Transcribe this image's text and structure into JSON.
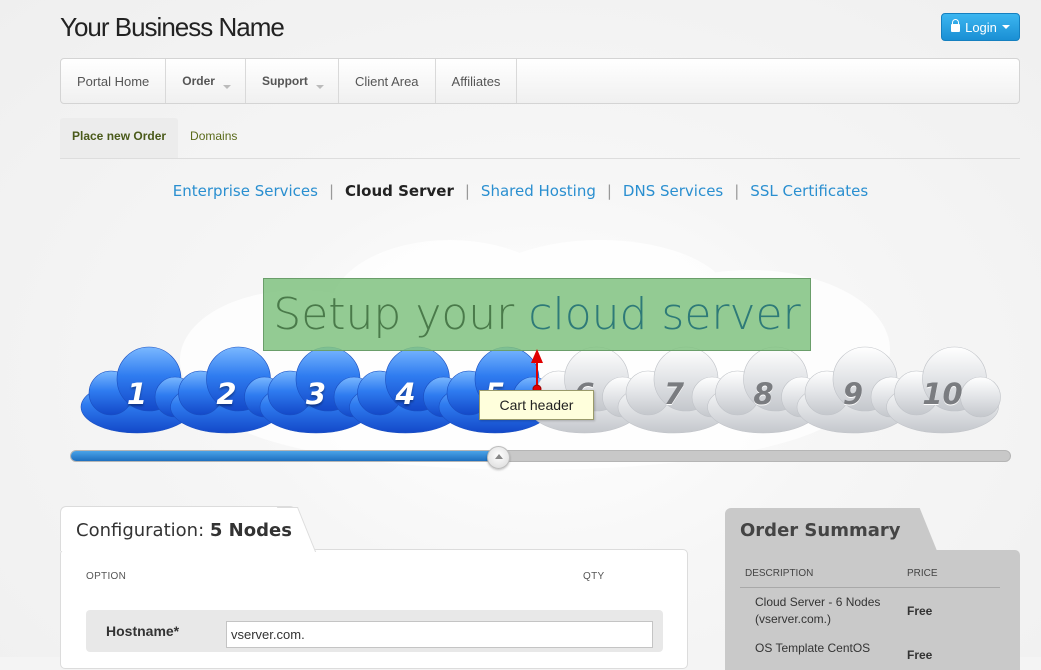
{
  "brand": {
    "name": "Your Business Name"
  },
  "login": {
    "label": "Login"
  },
  "nav": {
    "items": [
      {
        "label": "Portal Home"
      },
      {
        "label": "Order"
      },
      {
        "label": "Support"
      },
      {
        "label": "Client Area"
      },
      {
        "label": "Affiliates"
      }
    ]
  },
  "subnav": {
    "tabs": [
      {
        "label": "Place new Order"
      },
      {
        "label": "Domains"
      }
    ]
  },
  "categories": {
    "items": [
      {
        "label": "Enterprise Services"
      },
      {
        "label": "Cloud Server"
      },
      {
        "label": "Shared Hosting"
      },
      {
        "label": "DNS Services"
      },
      {
        "label": "SSL Certificates"
      }
    ],
    "separator": "|"
  },
  "banner": {
    "part1": "Setup your",
    "part2": "cloud server"
  },
  "node_selector": {
    "numbers": [
      "1",
      "2",
      "3",
      "4",
      "5",
      "6",
      "7",
      "8",
      "9",
      "10"
    ],
    "selected_count": 5,
    "slider_fraction": 0.455
  },
  "annotation": {
    "tooltip": "Cart header",
    "colors": {
      "fill": "#ffffdc",
      "arrow": "#e00000"
    }
  },
  "configuration": {
    "title_prefix": "Configuration:",
    "title_value": "5 Nodes",
    "col_option": "OPTION",
    "col_qty": "QTY",
    "hostname_label": "Hostname*",
    "hostname_value": "vserver.com."
  },
  "summary": {
    "title": "Order Summary",
    "col_description": "DESCRIPTION",
    "col_price": "PRICE",
    "items": [
      {
        "line1": "Cloud Server - 6 Nodes",
        "line2": "(vserver.com.)",
        "price": "Free"
      },
      {
        "line1": "OS Template CentOS",
        "price": "Free"
      }
    ]
  },
  "colors": {
    "accent": "#2a8fd0",
    "slider_fill": "#1e6fbf",
    "banner_bg": "#80c280",
    "cloud_on": "#2a6fe0",
    "cloud_off": "#d8dadd"
  }
}
